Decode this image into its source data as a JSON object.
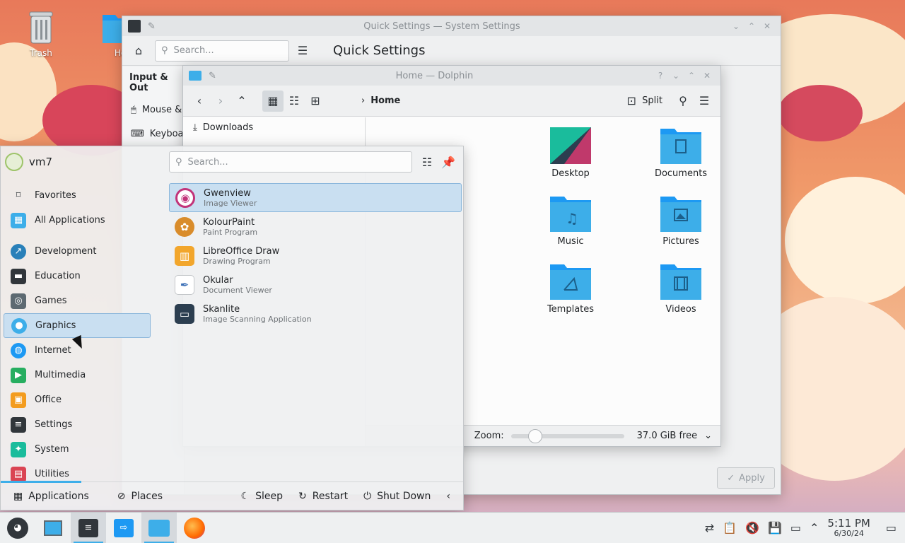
{
  "desktop": {
    "icons": [
      {
        "label": "Trash",
        "icon": "trash-icon"
      },
      {
        "label": "Ho",
        "icon": "home-folder-icon"
      }
    ]
  },
  "settings_window": {
    "title": "Quick Settings — System Settings",
    "search_placeholder": "Search...",
    "heading": "Quick Settings",
    "sidebar_group": "Input & Out",
    "sidebar_items": [
      {
        "label": "Mouse &",
        "icon": "mouse-icon"
      },
      {
        "label": "Keyboar",
        "icon": "keyboard-icon"
      }
    ],
    "apply_label": "Apply"
  },
  "dolphin_window": {
    "title": "Home — Dolphin",
    "breadcrumb": "Home",
    "split_label": "Split",
    "places": [
      {
        "label": "Downloads",
        "icon": "download-icon"
      }
    ],
    "folders": [
      {
        "label": "Desktop"
      },
      {
        "label": "Documents"
      },
      {
        "label": "Music"
      },
      {
        "label": "Pictures"
      },
      {
        "label": "Templates"
      },
      {
        "label": "Videos"
      }
    ],
    "zoom_label": "Zoom:",
    "free_space": "37.0 GiB free"
  },
  "launcher": {
    "username": "vm7",
    "search_placeholder": "Search...",
    "categories": [
      {
        "label": "Favorites",
        "icon": "bookmark-icon",
        "color": "#31363b"
      },
      {
        "label": "All Applications",
        "icon": "grid-icon",
        "color": "#3daee9"
      },
      {
        "label": "Development",
        "icon": "development-icon",
        "color": "#2980b9"
      },
      {
        "label": "Education",
        "icon": "education-icon",
        "color": "#31363b"
      },
      {
        "label": "Games",
        "icon": "gamepad-icon",
        "color": "#5d6a72"
      },
      {
        "label": "Graphics",
        "icon": "graphics-icon",
        "color": "#3daee9"
      },
      {
        "label": "Internet",
        "icon": "globe-icon",
        "color": "#1d99f3"
      },
      {
        "label": "Multimedia",
        "icon": "multimedia-icon",
        "color": "#27ae60"
      },
      {
        "label": "Office",
        "icon": "office-icon",
        "color": "#f39c1f"
      },
      {
        "label": "Settings",
        "icon": "settings-icon",
        "color": "#31363b"
      },
      {
        "label": "System",
        "icon": "system-icon",
        "color": "#1abc9c"
      },
      {
        "label": "Utilities",
        "icon": "toolbox-icon",
        "color": "#da4453"
      }
    ],
    "apps": [
      {
        "name": "Gwenview",
        "desc": "Image Viewer",
        "icon": "gwenview-icon",
        "color": "#c2347a"
      },
      {
        "name": "KolourPaint",
        "desc": "Paint Program",
        "icon": "palette-icon",
        "color": "#d98c2b"
      },
      {
        "name": "LibreOffice Draw",
        "desc": "Drawing Program",
        "icon": "libreoffice-draw-icon",
        "color": "#f2a62c"
      },
      {
        "name": "Okular",
        "desc": "Document Viewer",
        "icon": "okular-icon",
        "color": "#3b6fb6"
      },
      {
        "name": "Skanlite",
        "desc": "Image Scanning Application",
        "icon": "scanner-icon",
        "color": "#2c3e50"
      }
    ],
    "footer": {
      "applications": "Applications",
      "places": "Places",
      "sleep": "Sleep",
      "restart": "Restart",
      "shutdown": "Shut Down"
    }
  },
  "panel": {
    "time": "5:11 PM",
    "date": "6/30/24"
  }
}
